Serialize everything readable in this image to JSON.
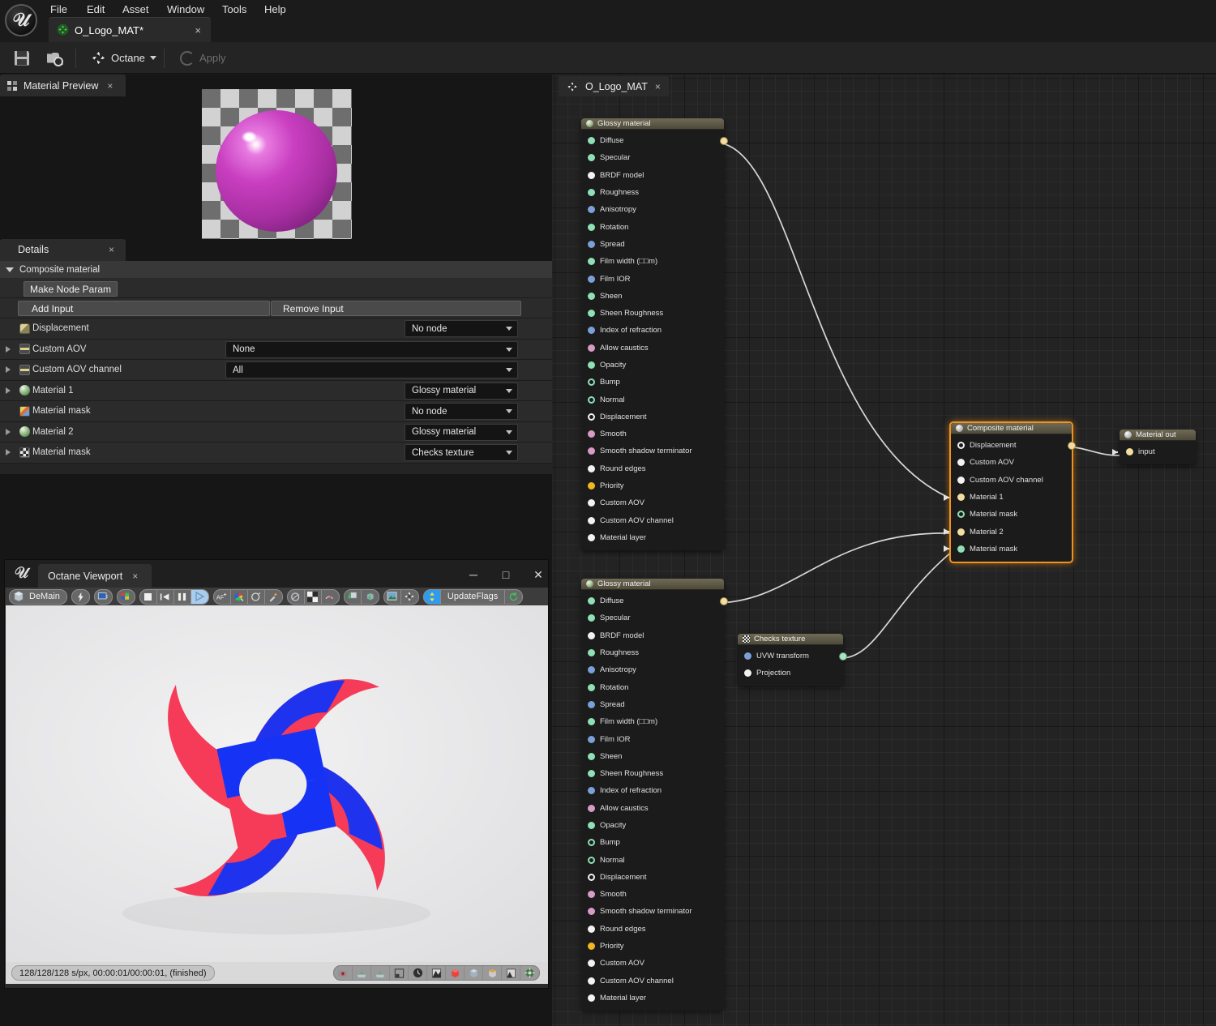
{
  "menu": {
    "items": [
      "File",
      "Edit",
      "Asset",
      "Window",
      "Tools",
      "Help"
    ]
  },
  "asset_tab": {
    "label": "O_Logo_MAT*",
    "icon": "octane-asset-icon",
    "close": "×"
  },
  "toolbar": {
    "save_label": "",
    "browse_label": "",
    "octane_label": "Octane",
    "apply_label": "Apply"
  },
  "material_preview": {
    "tab_label": "Material Preview",
    "tab_close": "×"
  },
  "details": {
    "tab_label": "Details",
    "tab_close": "×",
    "category": "Composite material",
    "make_node_param": "Make Node Param",
    "add_input": "Add Input",
    "remove_input": "Remove Input",
    "rows": [
      {
        "label": "Displacement",
        "icon": "displacement-icon",
        "value": "No node",
        "arrow": false,
        "wide": false
      },
      {
        "label": "Custom AOV",
        "icon": "aov-icon",
        "value": "None",
        "arrow": true,
        "wide": true
      },
      {
        "label": "Custom AOV channel",
        "icon": "aov-icon",
        "value": "All",
        "arrow": true,
        "wide": true
      },
      {
        "label": "Material 1",
        "icon": "sphere-icon",
        "value": "Glossy material",
        "arrow": true,
        "wide": false
      },
      {
        "label": "Material mask",
        "icon": "mask-icon",
        "value": "No node",
        "arrow": false,
        "wide": false
      },
      {
        "label": "Material 2",
        "icon": "sphere-icon",
        "value": "Glossy material",
        "arrow": true,
        "wide": false
      },
      {
        "label": "Material mask",
        "icon": "checks-icon",
        "value": "Checks texture",
        "arrow": true,
        "wide": false
      }
    ]
  },
  "octane_viewport": {
    "title_tab": "Octane Viewport",
    "tab_close": "×",
    "minimize": "─",
    "maximize": "□",
    "close": "✕",
    "toolbar": {
      "render_target_label": "DeMain",
      "update_flags_label": "UpdateFlags"
    },
    "status_text": "128/128/128 s/px, 00:00:01/00:00:01, (finished)"
  },
  "graph": {
    "tab_label": "O_Logo_MAT",
    "tab_close": "×",
    "accent_selected": "#f0921f",
    "wire_color": "#d8d8d8",
    "port_colors": {
      "green": "#8fe0b6",
      "blue": "#7b9fd6",
      "white": "#f2f2f2",
      "pink": "#d79cc6",
      "yellow": "#f0b81e",
      "ring_green": "#8fe0b6",
      "ring_white": "#f2f2f2"
    },
    "nodes": [
      {
        "id": "glossy1",
        "title": "Glossy material",
        "icon": "sphere-icon",
        "selected": false,
        "ports": [
          {
            "name": "Diffuse",
            "color": "green",
            "style": "fill",
            "out": true
          },
          {
            "name": "Specular",
            "color": "green",
            "style": "fill"
          },
          {
            "name": "BRDF model",
            "color": "white",
            "style": "fill"
          },
          {
            "name": "Roughness",
            "color": "green",
            "style": "fill"
          },
          {
            "name": "Anisotropy",
            "color": "blue",
            "style": "fill"
          },
          {
            "name": "Rotation",
            "color": "green",
            "style": "fill"
          },
          {
            "name": "Spread",
            "color": "blue",
            "style": "fill"
          },
          {
            "name": "Film width (□□m)",
            "color": "green",
            "style": "fill"
          },
          {
            "name": "Film IOR",
            "color": "blue",
            "style": "fill"
          },
          {
            "name": "Sheen",
            "color": "green",
            "style": "fill"
          },
          {
            "name": "Sheen Roughness",
            "color": "green",
            "style": "fill"
          },
          {
            "name": "Index of refraction",
            "color": "blue",
            "style": "fill"
          },
          {
            "name": "Allow caustics",
            "color": "pink",
            "style": "fill"
          },
          {
            "name": "Opacity",
            "color": "green",
            "style": "fill"
          },
          {
            "name": "Bump",
            "color": "green",
            "style": "ring"
          },
          {
            "name": "Normal",
            "color": "green",
            "style": "ring"
          },
          {
            "name": "Displacement",
            "color": "white",
            "style": "ring"
          },
          {
            "name": "Smooth",
            "color": "pink",
            "style": "fill"
          },
          {
            "name": "Smooth shadow terminator",
            "color": "pink",
            "style": "fill"
          },
          {
            "name": "Round edges",
            "color": "white",
            "style": "fill"
          },
          {
            "name": "Priority",
            "color": "yellow",
            "style": "fill"
          },
          {
            "name": "Custom AOV",
            "color": "white",
            "style": "fill"
          },
          {
            "name": "Custom AOV channel",
            "color": "white",
            "style": "fill"
          },
          {
            "name": "Material layer",
            "color": "white",
            "style": "fill"
          }
        ]
      },
      {
        "id": "glossy2",
        "title": "Glossy material",
        "icon": "sphere-icon",
        "selected": false,
        "ports": [
          {
            "name": "Diffuse",
            "color": "green",
            "style": "fill",
            "out": true
          },
          {
            "name": "Specular",
            "color": "green",
            "style": "fill"
          },
          {
            "name": "BRDF model",
            "color": "white",
            "style": "fill"
          },
          {
            "name": "Roughness",
            "color": "green",
            "style": "fill"
          },
          {
            "name": "Anisotropy",
            "color": "blue",
            "style": "fill"
          },
          {
            "name": "Rotation",
            "color": "green",
            "style": "fill"
          },
          {
            "name": "Spread",
            "color": "blue",
            "style": "fill"
          },
          {
            "name": "Film width (□□m)",
            "color": "green",
            "style": "fill"
          },
          {
            "name": "Film IOR",
            "color": "blue",
            "style": "fill"
          },
          {
            "name": "Sheen",
            "color": "green",
            "style": "fill"
          },
          {
            "name": "Sheen Roughness",
            "color": "green",
            "style": "fill"
          },
          {
            "name": "Index of refraction",
            "color": "blue",
            "style": "fill"
          },
          {
            "name": "Allow caustics",
            "color": "pink",
            "style": "fill"
          },
          {
            "name": "Opacity",
            "color": "green",
            "style": "fill"
          },
          {
            "name": "Bump",
            "color": "green",
            "style": "ring"
          },
          {
            "name": "Normal",
            "color": "green",
            "style": "ring"
          },
          {
            "name": "Displacement",
            "color": "white",
            "style": "ring"
          },
          {
            "name": "Smooth",
            "color": "pink",
            "style": "fill"
          },
          {
            "name": "Smooth shadow terminator",
            "color": "pink",
            "style": "fill"
          },
          {
            "name": "Round edges",
            "color": "white",
            "style": "fill"
          },
          {
            "name": "Priority",
            "color": "yellow",
            "style": "fill"
          },
          {
            "name": "Custom AOV",
            "color": "white",
            "style": "fill"
          },
          {
            "name": "Custom AOV channel",
            "color": "white",
            "style": "fill"
          },
          {
            "name": "Material layer",
            "color": "white",
            "style": "fill"
          }
        ]
      },
      {
        "id": "checks",
        "title": "Checks texture",
        "icon": "checks-icon",
        "selected": false,
        "ports": [
          {
            "name": "UVW transform",
            "color": "blue",
            "style": "fill",
            "out": true,
            "out_color": "green"
          },
          {
            "name": "Projection",
            "color": "white",
            "style": "fill"
          }
        ]
      },
      {
        "id": "composite",
        "title": "Composite material",
        "icon": "grey-sphere-icon",
        "selected": true,
        "ports": [
          {
            "name": "Displacement",
            "color": "white",
            "style": "ring",
            "out": true
          },
          {
            "name": "Custom AOV",
            "color": "white",
            "style": "fill"
          },
          {
            "name": "Custom AOV channel",
            "color": "white",
            "style": "fill"
          },
          {
            "name": "Material 1",
            "color": "yellow2",
            "style": "fill",
            "in": true
          },
          {
            "name": "Material mask",
            "color": "green",
            "style": "ring"
          },
          {
            "name": "Material 2",
            "color": "yellow2",
            "style": "fill",
            "in": true
          },
          {
            "name": "Material mask",
            "color": "green",
            "style": "fill",
            "in": true
          }
        ]
      },
      {
        "id": "matout",
        "title": "Material out",
        "icon": "grey-sphere-icon",
        "selected": false,
        "ports": [
          {
            "name": "input",
            "color": "yellow2",
            "style": "fill",
            "in": true
          }
        ]
      }
    ]
  }
}
